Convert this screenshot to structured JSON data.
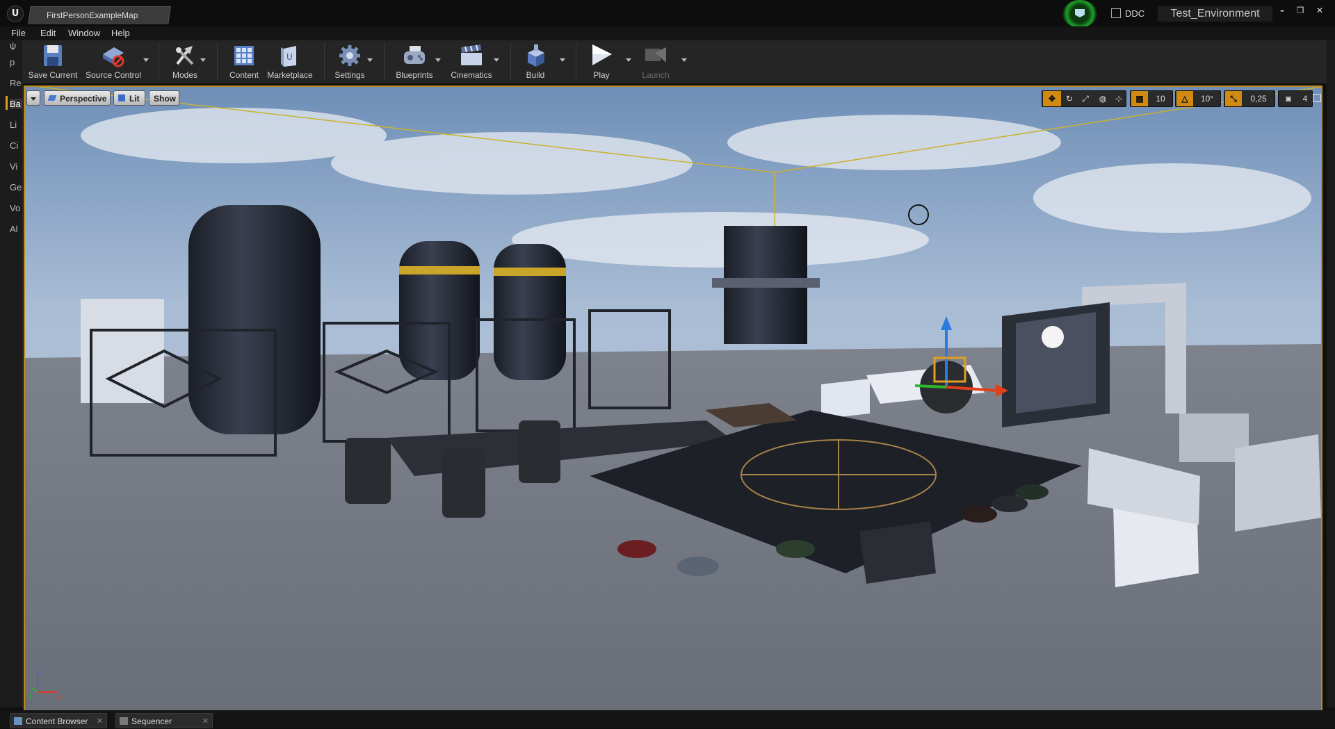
{
  "window": {
    "doc_tab": "FirstPersonExampleMap",
    "ddc_label": "DDC",
    "project_name": "Test_Environment",
    "controls": [
      "–",
      "❐",
      "✕"
    ]
  },
  "menu": [
    "File",
    "Edit",
    "Window",
    "Help"
  ],
  "left_rail": {
    "tabs": [
      "Re",
      "Ba",
      "Li",
      "Ci",
      "Vi",
      "Ge",
      "Vo",
      "Al"
    ],
    "active": "Ba",
    "top_icons": [
      "ψ",
      "p"
    ]
  },
  "toolbar": {
    "buttons": [
      {
        "label": "Save Current",
        "icon": "save-icon",
        "enabled": true
      },
      {
        "label": "Source Control",
        "icon": "source-control-icon",
        "enabled": true
      },
      {
        "label": "Modes",
        "icon": "modes-icon",
        "enabled": true
      },
      {
        "label": "Content",
        "icon": "content-icon",
        "enabled": true
      },
      {
        "label": "Marketplace",
        "icon": "marketplace-icon",
        "enabled": true
      },
      {
        "label": "Settings",
        "icon": "settings-icon",
        "enabled": true
      },
      {
        "label": "Blueprints",
        "icon": "blueprints-icon",
        "enabled": true
      },
      {
        "label": "Cinematics",
        "icon": "cinematics-icon",
        "enabled": true
      },
      {
        "label": "Build",
        "icon": "build-icon",
        "enabled": true
      },
      {
        "label": "Play",
        "icon": "play-icon",
        "enabled": true
      },
      {
        "label": "Launch",
        "icon": "launch-icon",
        "enabled": false
      }
    ]
  },
  "viewport": {
    "view_mode_button": "Perspective",
    "lighting_button": "Lit",
    "show_button": "Show",
    "snap": {
      "grid_value": "10",
      "rotation_value": "10°",
      "scale_value": "0,25",
      "camera_speed": "4"
    },
    "axis_labels": {
      "x": "x",
      "y": "y",
      "z": "z"
    },
    "colors": {
      "selection_border": "#b98b1f",
      "snap_active": "#d08a10",
      "gizmo_x": "#e0401a",
      "gizmo_y": "#2eb82e",
      "gizmo_z": "#2a7be0"
    }
  },
  "bottom_tabs": [
    {
      "label": "Content Browser"
    },
    {
      "label": "Sequencer"
    }
  ]
}
